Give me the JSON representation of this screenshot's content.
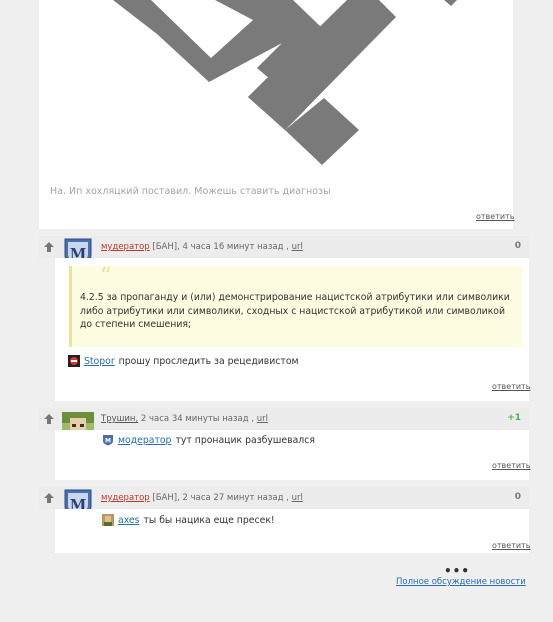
{
  "top_post": {
    "text": "На. Ип хохляцкий поставил. Можешь ставить диагнозы",
    "reply_label": "ответить"
  },
  "comments": [
    {
      "username": "мудератор",
      "ban": "[БАН],",
      "time": "4 часа 16 минут назад ,",
      "url": "url",
      "score": "0",
      "quote": "4.2.5 за пропаганду и (или) демонстрирование нацистской атрибутики или символики либо атрибутики или символики, сходных с нацистской атрибутикой или символикой до степени смешения;",
      "mention": "Stopor",
      "text": "прошу проследить за рецедивистом",
      "reply_label": "ответить"
    },
    {
      "username": "Трушин,",
      "time": "2 часа 34 минуты назад ,",
      "url": "url",
      "score": "+1",
      "mention": "модератор",
      "text": "тут пронацик разбушевался",
      "reply_label": "ответить"
    },
    {
      "username": "мудератор",
      "ban": "[БАН],",
      "time": "2 часа 27 минут назад ,",
      "url": "url",
      "score": "0",
      "mention": "axes",
      "text": "ты бы нацика еще пресек!",
      "reply_label": "ответить"
    }
  ],
  "footer": {
    "dots": "•••",
    "full_discussion": "Полное обсуждение новости"
  },
  "colors": {
    "background": "#efefef",
    "ban_username": "#c0392b",
    "link": "#2a6cb0",
    "positive_score": "#4caf50"
  }
}
